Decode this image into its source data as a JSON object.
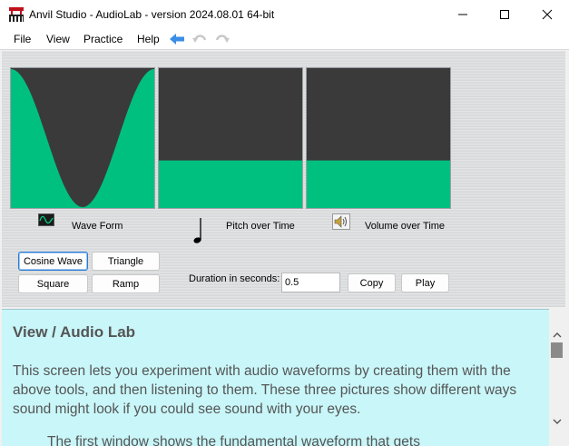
{
  "window": {
    "title": "Anvil Studio - AudioLab - version 2024.08.01 64-bit",
    "minimize_icon": "minimize-icon",
    "maximize_icon": "maximize-icon",
    "close_icon": "close-icon"
  },
  "menu": {
    "items": [
      "File",
      "View",
      "Practice",
      "Help"
    ],
    "tools": [
      "back-arrow-icon",
      "undo-icon",
      "redo-icon"
    ]
  },
  "panels": {
    "wave_label": "Wave Form",
    "pitch_label": "Pitch over Time",
    "volume_label": "Volume over Time",
    "pitch_level": 0.34,
    "volume_level": 0.34,
    "fill_color": "#00c080",
    "background_color": "#3a3a3a"
  },
  "waveform_buttons": {
    "cosine": "Cosine Wave",
    "triangle": "Triangle",
    "square": "Square",
    "ramp": "Ramp",
    "selected": "Cosine Wave"
  },
  "duration": {
    "label": "Duration in seconds:",
    "value": "0.5",
    "copy": "Copy",
    "play": "Play"
  },
  "help": {
    "title": "View / Audio Lab",
    "body": "This screen lets you experiment with audio waveforms by creating them with the above tools, and then listening to them. These three pictures show different ways sound might look if you could see sound with your eyes.",
    "partial": "The first window shows the fundamental waveform that gets"
  }
}
